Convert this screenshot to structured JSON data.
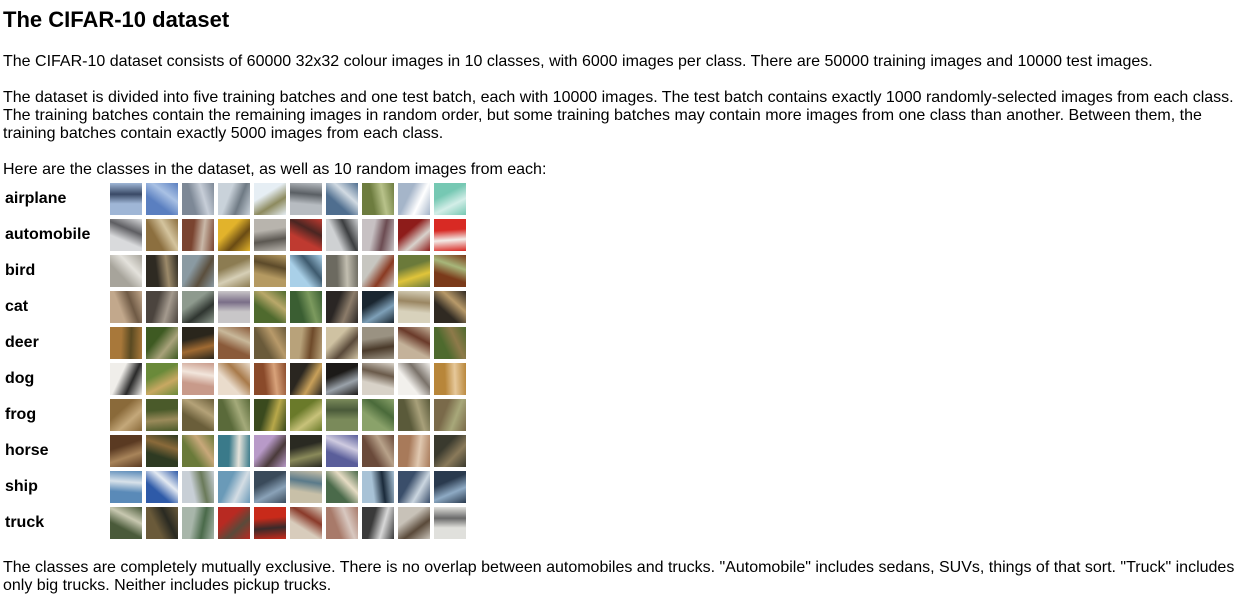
{
  "title": "The CIFAR-10 dataset",
  "paragraphs": {
    "intro": "The CIFAR-10 dataset consists of 60000 32x32 colour images in 10 classes, with 6000 images per class. There are 50000 training images and 10000 test images.",
    "batches": "The dataset is divided into five training batches and one test batch, each with 10000 images. The test batch contains exactly 1000 randomly-selected images from each class. The training batches contain the remaining images in random order, but some training batches may contain more images from one class than another. Between them, the training batches contain exactly 5000 images from each class.",
    "classes_intro": "Here are the classes in the dataset, as well as 10 random images from each:",
    "exclusive": "The classes are completely mutually exclusive. There is no overlap between automobiles and trucks. \"Automobile\" includes sedans, SUVs, things of that sort. \"Truck\" includes only big trucks. Neither includes pickup trucks."
  },
  "classes": [
    {
      "label": "airplane",
      "colors": [
        [
          "#9fb6d6",
          "#3a4a66"
        ],
        [
          "#5a7fc0",
          "#a9c1e4"
        ],
        [
          "#7d8896",
          "#c7ced8"
        ],
        [
          "#c9d2da",
          "#6f7a84"
        ],
        [
          "#e6eef4",
          "#8d8a5e"
        ],
        [
          "#b7bcc1",
          "#5a5f64"
        ],
        [
          "#4f6e8f",
          "#d2dbe3"
        ],
        [
          "#6d7c3f",
          "#b8c28a"
        ],
        [
          "#a5b5c9",
          "#ffffff"
        ],
        [
          "#76c8b3",
          "#d3eee8"
        ]
      ]
    },
    {
      "label": "automobile",
      "colors": [
        [
          "#d9dadc",
          "#5e5e62"
        ],
        [
          "#8c6f3f",
          "#d4c49e"
        ],
        [
          "#7a4430",
          "#c9b8a8"
        ],
        [
          "#e2b32b",
          "#6a4b14"
        ],
        [
          "#b8b4ad",
          "#5c5852"
        ],
        [
          "#bf3a30",
          "#4a2622"
        ],
        [
          "#cfd1d3",
          "#3c3e40"
        ],
        [
          "#c7c1c3",
          "#6c4c52"
        ],
        [
          "#8e1c1a",
          "#d8d2cc"
        ],
        [
          "#d82a24",
          "#f3ece8"
        ]
      ]
    },
    {
      "label": "bird",
      "colors": [
        [
          "#a7a49b",
          "#e4e2dc"
        ],
        [
          "#2e2a22",
          "#9c8a6a"
        ],
        [
          "#8a9aa2",
          "#5b4f3d"
        ],
        [
          "#8c7c52",
          "#d6cfb6"
        ],
        [
          "#b59a62",
          "#5c4a2a"
        ],
        [
          "#a9d0e8",
          "#3e5a6e"
        ],
        [
          "#6c6a60",
          "#c2beb0"
        ],
        [
          "#c7c6c0",
          "#8a3a22"
        ],
        [
          "#6b7a3a",
          "#e0c43a"
        ],
        [
          "#7a3a1a",
          "#a7b67a"
        ]
      ]
    },
    {
      "label": "cat",
      "colors": [
        [
          "#c2a88c",
          "#6f5a45"
        ],
        [
          "#4b443e",
          "#a49a8e"
        ],
        [
          "#8e9a8e",
          "#2f3530"
        ],
        [
          "#c8c6c8",
          "#7a6e88"
        ],
        [
          "#4f6a2e",
          "#b9a86a"
        ],
        [
          "#3a5e32",
          "#7c9a5e"
        ],
        [
          "#2a2624",
          "#8c7c6a"
        ],
        [
          "#1a2630",
          "#7ea0b8"
        ],
        [
          "#d8d2bc",
          "#9a8662"
        ],
        [
          "#302a22",
          "#b89a6a"
        ]
      ]
    },
    {
      "label": "deer",
      "colors": [
        [
          "#a8783a",
          "#5a4a22"
        ],
        [
          "#3e5a22",
          "#a8a27a"
        ],
        [
          "#2a261c",
          "#a06a32"
        ],
        [
          "#8a5a3a",
          "#c8b89a"
        ],
        [
          "#6a5a3a",
          "#b89a6a"
        ],
        [
          "#b8a27a",
          "#6e4a2a"
        ],
        [
          "#cfc2a2",
          "#5a4a3a"
        ],
        [
          "#9a9282",
          "#4a3a2a"
        ],
        [
          "#c4b29a",
          "#6a3a2a"
        ],
        [
          "#4e6a2e",
          "#8e7a4a"
        ]
      ]
    },
    {
      "label": "dog",
      "colors": [
        [
          "#f0eeea",
          "#2a2a2a"
        ],
        [
          "#6a8a3a",
          "#c8a862"
        ],
        [
          "#c89a8a",
          "#f2e6dc"
        ],
        [
          "#eadccc",
          "#a87a4a"
        ],
        [
          "#8a4a2a",
          "#d8a27a"
        ],
        [
          "#2a2620",
          "#c8a05a"
        ],
        [
          "#1c1a18",
          "#9aa2aa"
        ],
        [
          "#d8d2c8",
          "#6a5a4a"
        ],
        [
          "#f2f0ec",
          "#7a726a"
        ],
        [
          "#b8863a",
          "#e6c89a"
        ]
      ]
    },
    {
      "label": "frog",
      "colors": [
        [
          "#8a6a3a",
          "#c4a87a"
        ],
        [
          "#4a5a2a",
          "#9a8a5a"
        ],
        [
          "#6a5e3a",
          "#b4a278"
        ],
        [
          "#5a6a3a",
          "#a4aa7a"
        ],
        [
          "#3a4a1e",
          "#b8a84a"
        ],
        [
          "#6a7a2a",
          "#c8c27a"
        ],
        [
          "#7a8a5a",
          "#4a5a3a"
        ],
        [
          "#8aa26a",
          "#4a6a3a"
        ],
        [
          "#5a5a3a",
          "#a8a07a"
        ],
        [
          "#7a6a4a",
          "#a8a87a"
        ]
      ]
    },
    {
      "label": "horse",
      "colors": [
        [
          "#5a3a22",
          "#a8845a"
        ],
        [
          "#2e3a22",
          "#8a6a3a"
        ],
        [
          "#6a7a3a",
          "#c8a87a"
        ],
        [
          "#3a7a8a",
          "#e4e2da"
        ],
        [
          "#b89ac8",
          "#4a3a3a"
        ],
        [
          "#2a2a22",
          "#8a8a5a"
        ],
        [
          "#5a5e9a",
          "#cfcbe0"
        ],
        [
          "#6a4a3a",
          "#b8a28a"
        ],
        [
          "#a87a5a",
          "#e0c8b0"
        ],
        [
          "#3a3a2e",
          "#8a7a5a"
        ]
      ]
    },
    {
      "label": "ship",
      "colors": [
        [
          "#5a8ab8",
          "#d8e2ea"
        ],
        [
          "#2e5aa8",
          "#e4eaf2"
        ],
        [
          "#c8cfd6",
          "#6a7a5a"
        ],
        [
          "#6a9ab8",
          "#d4dde4"
        ],
        [
          "#3a4a5a",
          "#8aa2b8"
        ],
        [
          "#c8c0a8",
          "#5a7a8a"
        ],
        [
          "#4a6a4a",
          "#e6dcc4"
        ],
        [
          "#a8c2d6",
          "#1a2a3a"
        ],
        [
          "#3a4e6a",
          "#cbd6e0"
        ],
        [
          "#2a3a4e",
          "#8eaac4"
        ]
      ]
    },
    {
      "label": "truck",
      "colors": [
        [
          "#4a5a3a",
          "#c8c8b0"
        ],
        [
          "#6a5a3a",
          "#2a2a22"
        ],
        [
          "#a8b6aa",
          "#4a6a4a"
        ],
        [
          "#b82a22",
          "#5a4a3a"
        ],
        [
          "#c82a1a",
          "#3a2a2a"
        ],
        [
          "#d8ccbc",
          "#8a3a2a"
        ],
        [
          "#a87a6a",
          "#d8c8c0"
        ],
        [
          "#3a3a3a",
          "#d8d8d8"
        ],
        [
          "#c8c2b8",
          "#5a4a3a"
        ],
        [
          "#e0e0dc",
          "#6a6a6a"
        ]
      ]
    }
  ]
}
